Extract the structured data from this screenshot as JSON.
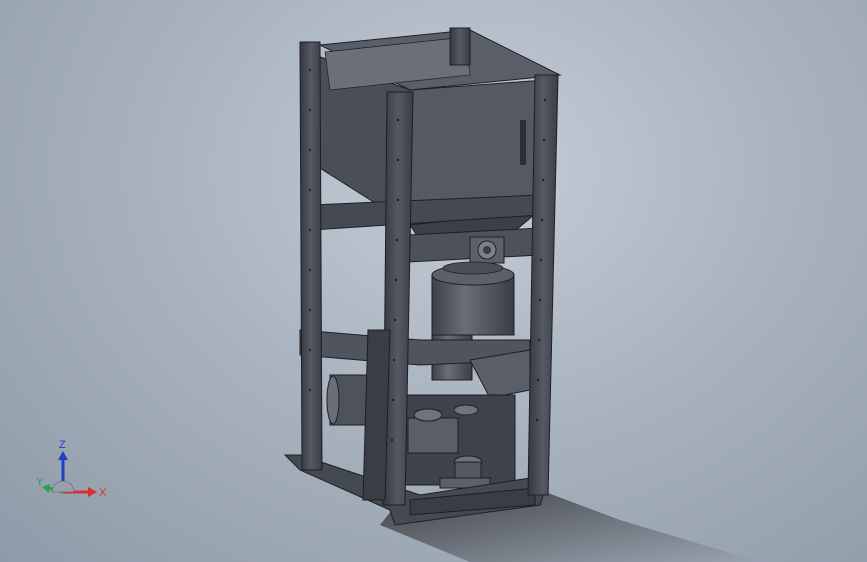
{
  "viewport": {
    "background_top": "#c4ccd6",
    "background_bottom": "#8f9aa8"
  },
  "model": {
    "body_color": "#4b4f58",
    "face_dark": "#3a3d45",
    "face_light": "#5d616b",
    "edge_color": "#1e1f24",
    "shadow_color": "#2b2b2e"
  },
  "triad": {
    "x_label": "X",
    "y_label": "Y",
    "z_label": "Z",
    "x_color": "#d83030",
    "y_color": "#2aa34a",
    "z_color": "#2040c8",
    "icons": [
      "x-axis-icon",
      "y-axis-icon",
      "z-axis-icon",
      "origin-sphere-icon"
    ]
  }
}
